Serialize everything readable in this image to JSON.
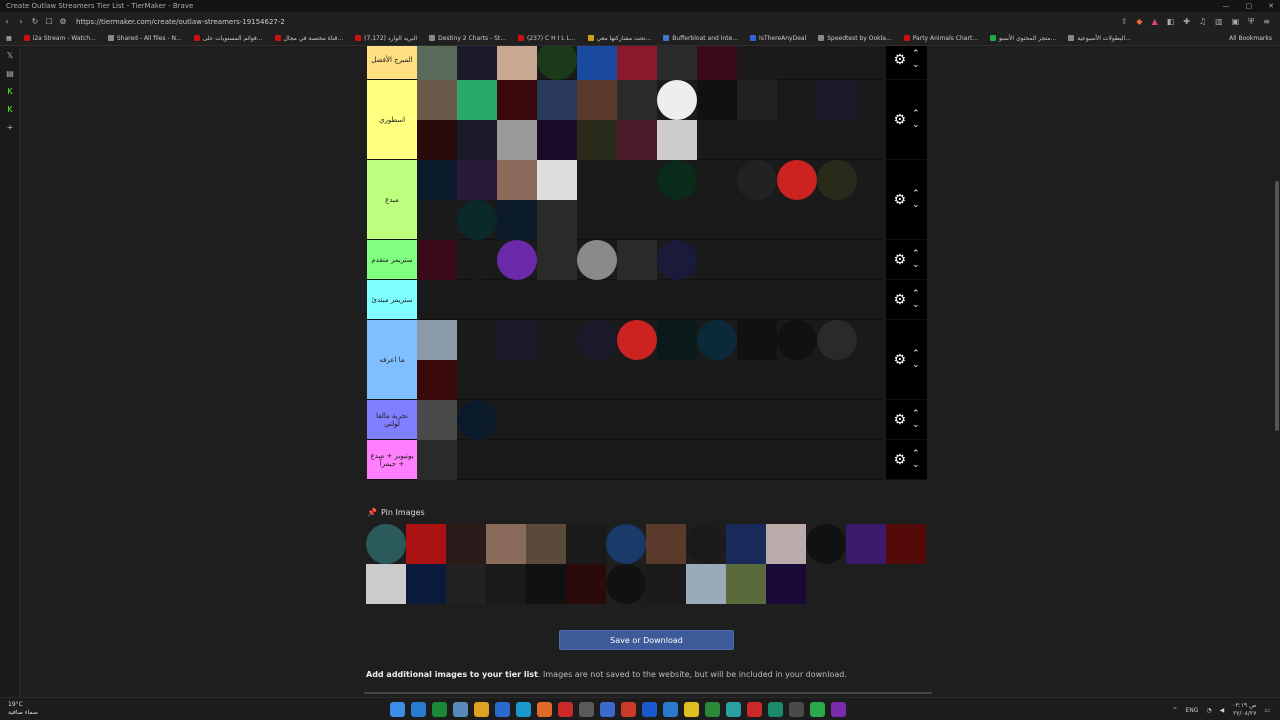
{
  "browser": {
    "tab_title": "Create Outlaw Streamers Tier List - TierMaker - Brave",
    "url": "https://tiermaker.com/create/outlaw-streamers-19154627-2",
    "all_bookmarks": "All Bookmarks",
    "bookmarks": [
      {
        "label": "i2a Stream - Watch...",
        "color": "#cc1111"
      },
      {
        "label": "Shared - All files - N...",
        "color": "#888888"
      },
      {
        "label": "قوائم المستويات على...",
        "color": "#cc1111"
      },
      {
        "label": "قناة مختصة في مجال...",
        "color": "#cc1111"
      },
      {
        "label": "البريد الوارد (7,172)",
        "color": "#cc1111"
      },
      {
        "label": "Destiny 2 Charts - St...",
        "color": "#888888"
      },
      {
        "label": "(237) C H I L L...",
        "color": "#cc1111"
      },
      {
        "label": "تحت مشاركتها معي...",
        "color": "#d4a017"
      },
      {
        "label": "Bufferbloat and Inte...",
        "color": "#4477cc"
      },
      {
        "label": "IsThereAnyDeal",
        "color": "#3366dd"
      },
      {
        "label": "Speedtest by Ookla...",
        "color": "#888888"
      },
      {
        "label": "Party Animals Chart...",
        "color": "#cc1111"
      },
      {
        "label": "متجر المحتوى الأسبو...",
        "color": "#22aa44"
      },
      {
        "label": "البطولات الأسبوعية...",
        "color": "#888888"
      }
    ]
  },
  "tiers": [
    {
      "label": "المبرج الأفضل",
      "color": "#ffdf80",
      "height": 40,
      "items": [
        [
          "avatar",
          "#5a6a5a"
        ],
        [
          "R",
          "#1a1a2a"
        ],
        [
          "dial",
          "#c8a890"
        ],
        [
          "ring",
          "#1a3a1a"
        ],
        [
          "IW3",
          "#1a4aa0"
        ],
        [
          "mask",
          "#8a1a2a"
        ],
        [
          "bird",
          "#2a2a2a"
        ],
        [
          "rose",
          "#3a0a1a"
        ],
        [
          "star",
          "#1a1a1a"
        ]
      ]
    },
    {
      "label": "اسطوري",
      "color": "#ffff80",
      "height": 80,
      "items": [
        [
          "man",
          "#6a5a4a"
        ],
        [
          "zz",
          "#2aaa6a"
        ],
        [
          "red",
          "#3a0a0a"
        ],
        [
          "KK",
          "#2a3a5a"
        ],
        [
          "girl",
          "#5a3a2a"
        ],
        [
          "NX",
          "#2a2a2a"
        ],
        [
          "L",
          "#eeeeee"
        ],
        [
          "blk",
          "#111111"
        ],
        [
          "hood",
          "#222222"
        ],
        [
          "5",
          "#1a1a1a"
        ],
        [
          "P",
          "#1a1a2a"
        ],
        [
          "skull",
          "#2a0a0a"
        ],
        [
          "blue",
          "#1a1a2a"
        ],
        [
          "white",
          "#9a9a9a"
        ],
        [
          "purple",
          "#1a0a2a"
        ],
        [
          "SKZ",
          "#2a2a1a"
        ],
        [
          "angel",
          "#4a1a2a"
        ],
        [
          "sketch",
          "#cccccc"
        ]
      ]
    },
    {
      "label": "مبدع",
      "color": "#bfff7f",
      "height": 80,
      "items": [
        [
          "R",
          "#0a1a2a"
        ],
        [
          "eyes",
          "#2a1a3a"
        ],
        [
          "woman",
          "#8a6a5a"
        ],
        [
          "wing",
          "#dddddd"
        ],
        [
          "E",
          "#1a1a1a"
        ],
        [
          "anime",
          "#1a1a1a"
        ],
        [
          "G",
          "#0a2a1a"
        ],
        [
          "M",
          "#1a1a1a"
        ],
        [
          "M3",
          "#222222"
        ],
        [
          "wolf",
          "#cc2222"
        ],
        [
          "DL",
          "#2a2a1a"
        ],
        [
          "VX",
          "#1a1a1a"
        ],
        [
          "S",
          "#0a2a2a"
        ],
        [
          "blue",
          "#0a1a2a"
        ],
        [
          "kiss",
          "#2a2a2a"
        ]
      ]
    },
    {
      "label": "ستريمر متقدم",
      "color": "#80ff80",
      "height": 40,
      "items": [
        [
          "skull",
          "#3a0a1a"
        ],
        [
          "D",
          "#1a1a1a"
        ],
        [
          "X",
          "#6a2aaa"
        ],
        [
          "HM",
          "#2a2a2a"
        ],
        [
          "wolf",
          "#8a8a8a"
        ],
        [
          "B",
          "#2a2a2a"
        ],
        [
          "S",
          "#1a1a3a"
        ]
      ]
    },
    {
      "label": "ستريمر مبتدئ",
      "color": "#7fffff",
      "height": 40,
      "items": []
    },
    {
      "label": "ما اعرفه",
      "color": "#7fbfff",
      "height": 80,
      "items": [
        [
          "anime",
          "#8a9aaa"
        ],
        [
          "dark",
          "#1a1a1a"
        ],
        [
          "girl",
          "#1a1a2a"
        ],
        [
          "hood",
          "#1a1a1a"
        ],
        [
          "E",
          "#1a1a2a"
        ],
        [
          "D",
          "#cc2222"
        ],
        [
          "M",
          "#0a1a1a"
        ],
        [
          "6",
          "#0a2a3a"
        ],
        [
          "A",
          "#111111"
        ],
        [
          "AB",
          "#111111"
        ],
        [
          "J",
          "#2a2a2a"
        ],
        [
          "RUST",
          "#3a0a0a"
        ]
      ]
    },
    {
      "label": "تجربة مالقا لولتي",
      "color": "#7f7fff",
      "height": 40,
      "items": [
        [
          "road",
          "#4a4a4a"
        ],
        [
          "RXO",
          "#0a1a2a"
        ]
      ]
    },
    {
      "label": "يوتيوبر + مبدع + جيمراً",
      "color": "#ff7fff",
      "height": 40,
      "items": [
        [
          "dark",
          "#2a2a2a"
        ]
      ]
    }
  ],
  "pin_images": {
    "title": "Pin Images",
    "items": [
      [
        "S",
        "#2a5a5a"
      ],
      [
        "red",
        "#aa1111"
      ],
      [
        "demon",
        "#2a1a1a"
      ],
      [
        "man",
        "#8a6a5a"
      ],
      [
        "man2",
        "#5a4a3a"
      ],
      [
        "bird",
        "#1a1a1a"
      ],
      [
        "C",
        "#1a3a6a"
      ],
      [
        "beard",
        "#5a3a2a"
      ],
      [
        "ring",
        "#1a1a1a"
      ],
      [
        "blue",
        "#1a2a5a"
      ],
      [
        "girl",
        "#bbaaaa"
      ],
      [
        "X",
        "#111111"
      ],
      [
        "B",
        "#3a1a6a"
      ],
      [
        "red2",
        "#550a0a"
      ],
      [
        "hand",
        "#cccccc"
      ],
      [
        "SB",
        "#0a1a3a"
      ],
      [
        "M",
        "#222222"
      ],
      [
        "F",
        "#1a1a1a"
      ],
      [
        "mask",
        "#111111"
      ],
      [
        "D7",
        "#2a0a0a"
      ],
      [
        "L",
        "#111111"
      ],
      [
        "dark",
        "#1a1a1a"
      ],
      [
        "man3",
        "#9aaaba"
      ],
      [
        "soldier",
        "#5a6a3a"
      ],
      [
        "RD",
        "#1a0a3a"
      ]
    ]
  },
  "save_button": "Save or Download",
  "add_info": {
    "bold": "Add additional images to your tier list",
    "text": ". Images are not saved to the website, but will be included in your download."
  },
  "taskbar": {
    "temp": "19°C",
    "weather": "سماء صافية",
    "lang": "ENG",
    "time": "۰۳:۱۹ ص",
    "date": "۲۷/۰۸/۲۷"
  }
}
